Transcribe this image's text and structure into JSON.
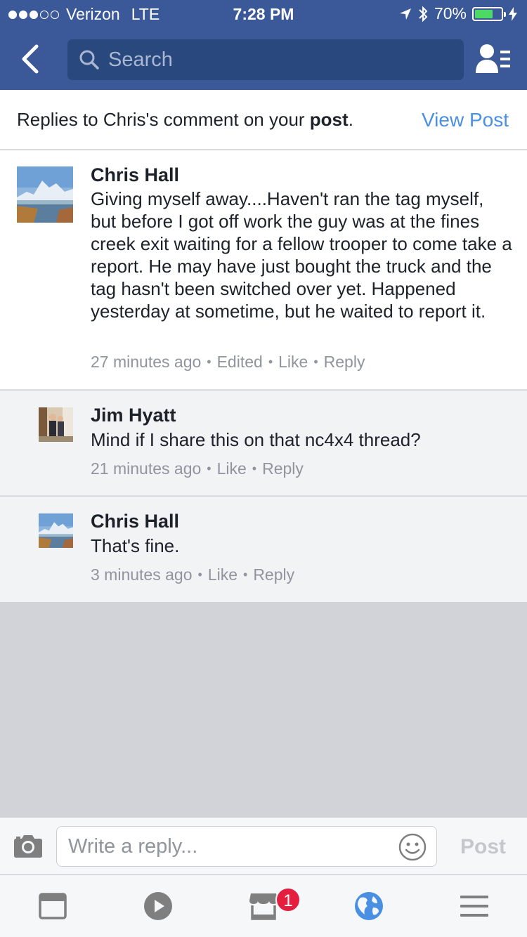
{
  "status_bar": {
    "carrier": "Verizon",
    "network": "LTE",
    "time": "7:28 PM",
    "battery_percent": "70%",
    "signal_bars_filled": 3,
    "signal_bars_total": 5,
    "battery_level": 0.7
  },
  "nav": {
    "back_icon": "chevron-left-icon",
    "search_placeholder": "Search",
    "friends_icon": "friend-requests-icon"
  },
  "header": {
    "text_prefix": "Replies to Chris's comment on your ",
    "text_bold": "post",
    "text_suffix": ".",
    "view_post": "View Post"
  },
  "comments": [
    {
      "author": "Chris Hall",
      "text": "Giving myself away....Haven't ran the tag myself, but before I got off work the guy was at the fines creek exit waiting for a fellow trooper to come take a report. He may have just bought the truck and the tag hasn't been switched over yet. Happened yesterday at sometime, but he waited to report it.",
      "time": "27 minutes ago",
      "edited": "Edited",
      "like": "Like",
      "reply": "Reply"
    },
    {
      "author": "Jim Hyatt",
      "text": "Mind if I share this on that nc4x4 thread?",
      "time": "21 minutes ago",
      "like": "Like",
      "reply": "Reply"
    },
    {
      "author": "Chris Hall",
      "text": "That's fine.",
      "time": "3 minutes ago",
      "like": "Like",
      "reply": "Reply"
    }
  ],
  "composer": {
    "placeholder": "Write a reply...",
    "post": "Post"
  },
  "tabbar": {
    "items": [
      "news-feed-icon",
      "video-icon",
      "marketplace-icon",
      "notifications-globe-icon",
      "more-menu-icon"
    ],
    "marketplace_badge": "1"
  },
  "colors": {
    "brand": "#3b5998",
    "link": "#4a90e2",
    "badge": "#e41e3f"
  }
}
